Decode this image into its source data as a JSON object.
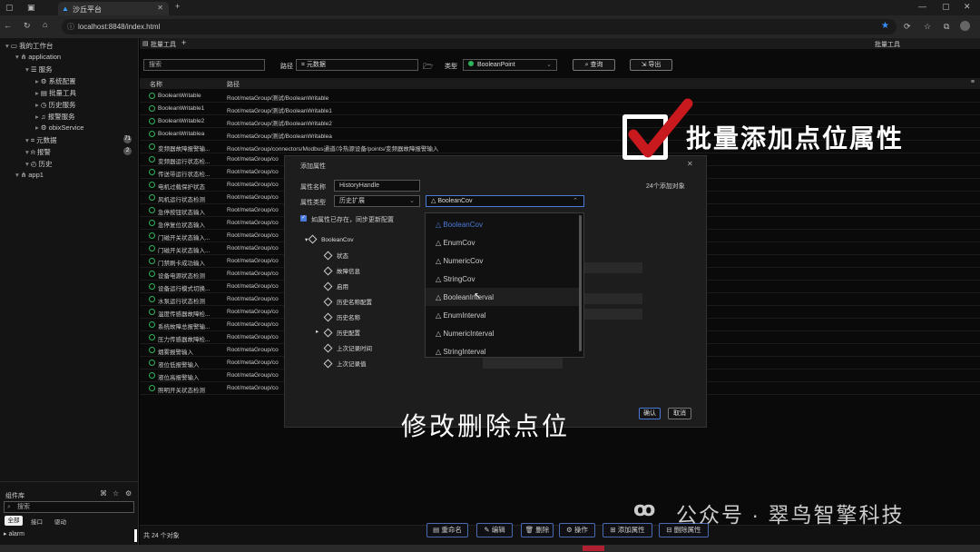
{
  "browser": {
    "tab_title": "沙丘平台",
    "url": "localhost:8848/index.html"
  },
  "sidebar": {
    "items": [
      {
        "label": "我的工作台",
        "indent": 0,
        "icon": "monitor-icon"
      },
      {
        "label": "application",
        "indent": 1,
        "icon": "network-icon"
      },
      {
        "label": "服务",
        "indent": 2,
        "icon": "server-icon"
      },
      {
        "label": "系统配置",
        "indent": 3,
        "icon": "settings-icon"
      },
      {
        "label": "批量工具",
        "indent": 3,
        "icon": "tool-icon"
      },
      {
        "label": "历史服务",
        "indent": 3,
        "icon": "history-icon"
      },
      {
        "label": "报警服务",
        "indent": 3,
        "icon": "alarm-icon"
      },
      {
        "label": "obixService",
        "indent": 3,
        "icon": "gear-icon"
      },
      {
        "label": "元数据",
        "indent": 2,
        "icon": "tag-icon",
        "badge": "71"
      },
      {
        "label": "报警",
        "indent": 2,
        "icon": "bell-icon",
        "badge": "2"
      },
      {
        "label": "历史",
        "indent": 2,
        "icon": "clock-icon"
      },
      {
        "label": "app1",
        "indent": 1,
        "icon": "network-icon"
      }
    ],
    "palette": {
      "title": "组件库",
      "search_placeholder": "搜索",
      "tabs": [
        "全部",
        "接口",
        "驱动"
      ],
      "item": "alarm"
    }
  },
  "main": {
    "tab_label": "批量工具",
    "right_label": "批量工具",
    "search_placeholder": "搜索",
    "path_label": "路径",
    "path_value": "元数据",
    "type_label": "类型",
    "type_value": "BooleanPoint",
    "query_btn": "查询",
    "export_btn": "导出",
    "col_name": "名称",
    "col_path": "路径",
    "rows": [
      [
        "BooleanWritable",
        "Root/metaGroup/测试/BooleanWritable"
      ],
      [
        "BooleanWritable1",
        "Root/metaGroup/测试/BooleanWritable1"
      ],
      [
        "BooleanWritable2",
        "Root/metaGroup/测试/BooleanWritable2"
      ],
      [
        "BooleanWritablea",
        "Root/metaGroup/测试/BooleanWritablea"
      ],
      [
        "变频器故障报警输...",
        "Root/metaGroup/connectors/Modbus通道/冷热源设备/points/变频器故障报警输入"
      ],
      [
        "变频器运行状态检...",
        "Root/metaGroup/co"
      ],
      [
        "传送带运行状态检...",
        "Root/metaGroup/co"
      ],
      [
        "电机过载保护状态",
        "Root/metaGroup/co"
      ],
      [
        "风机运行状态检测",
        "Root/metaGroup/co"
      ],
      [
        "急停按钮状态输入",
        "Root/metaGroup/co"
      ],
      [
        "急停复位状态输入",
        "Root/metaGroup/co"
      ],
      [
        "门磁开关状态输入...",
        "Root/metaGroup/co"
      ],
      [
        "门磁开关状态输入...",
        "Root/metaGroup/co"
      ],
      [
        "门禁刷卡成功输入",
        "Root/metaGroup/co"
      ],
      [
        "设备电源状态检测",
        "Root/metaGroup/co"
      ],
      [
        "设备运行模式切换...",
        "Root/metaGroup/co"
      ],
      [
        "水泵运行状态检测",
        "Root/metaGroup/co"
      ],
      [
        "温度传感器故障检...",
        "Root/metaGroup/co"
      ],
      [
        "系统故障总报警输...",
        "Root/metaGroup/co"
      ],
      [
        "压力传感器故障检...",
        "Root/metaGroup/co"
      ],
      [
        "烟雾报警输入",
        "Root/metaGroup/co"
      ],
      [
        "液位低报警输入",
        "Root/metaGroup/co"
      ],
      [
        "液位高报警输入",
        "Root/metaGroup/co"
      ],
      [
        "照明开关状态检测",
        "Root/metaGroup/co"
      ]
    ],
    "count_text": "共 24 个对象",
    "actions": [
      "重命名",
      "编辑",
      "删除",
      "操作",
      "添加属性",
      "删除属性"
    ]
  },
  "dialog": {
    "title": "添加属性",
    "name_label": "属性名称",
    "name_value": "HistoryHandle",
    "count_text": "24个添加对象",
    "type_label": "属性类型",
    "type_value": "历史扩展",
    "class_value": "BooleanCov",
    "checkbox_label": "如属性已存在，同步更新配置",
    "tree_root": "BooleanCov",
    "tree_children": [
      "状态",
      "故障信息",
      "启用",
      "历史名称配置",
      "历史名称",
      "历史配置",
      "上次记录时间",
      "上次记录值"
    ],
    "confirm": "确认",
    "cancel": "取消"
  },
  "dropdown": {
    "options": [
      "BooleanCov",
      "EnumCov",
      "NumericCov",
      "StringCov",
      "BooleanInterval",
      "EnumInterval",
      "NumericInterval",
      "StringInterval"
    ],
    "selected": "BooleanCov"
  },
  "overlay": {
    "heading": "批量添加点位属性",
    "subtitle": "修改删除点位",
    "watermark": "公众号 · 翠鸟智擎科技"
  },
  "colors": {
    "accent": "#4a7bd8",
    "status_green": "#2fb45a",
    "check_red": "#c8191e"
  }
}
